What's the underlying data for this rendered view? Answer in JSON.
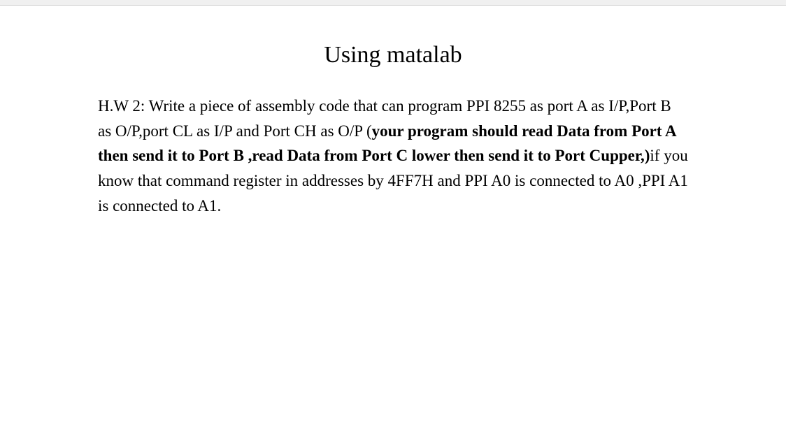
{
  "title": "Using matalab",
  "paragraph": {
    "part1": "H.W 2: Write a piece of assembly code that can program PPI 8255 as port A as I/P,Port B as O/P,port CL as I/P and Port CH as O/P (",
    "bold1": "your program should read Data from Port A then send it to Port B ,read Data from Port C lower then send it to Port Cupper,)",
    "part2": "if you know that command register in addresses by 4FF7H   and PPI  A0 is connected to  A0 ,PPI A1 is connected to A1."
  }
}
